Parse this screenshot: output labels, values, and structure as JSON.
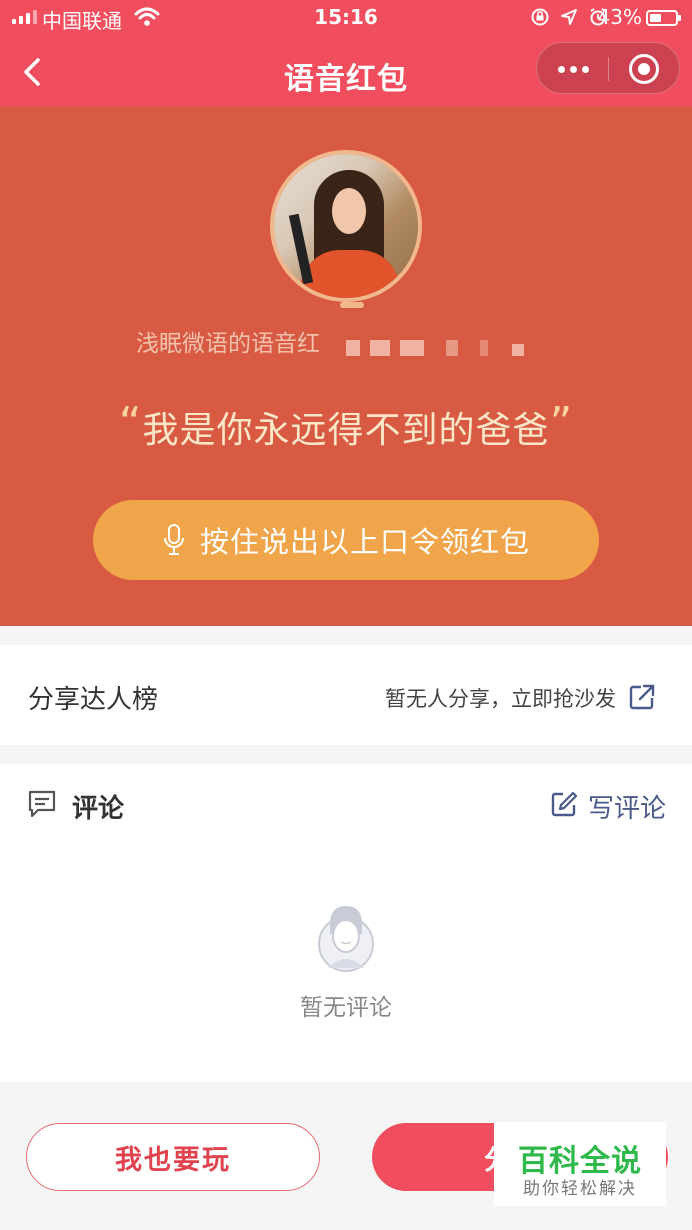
{
  "status_bar": {
    "carrier": "中国联通",
    "time": "15:16",
    "battery_percent": "43%",
    "battery_level": 0.43,
    "icons": [
      "signal-icon",
      "wifi-icon",
      "lock-rotation-icon",
      "location-icon",
      "alarm-icon",
      "battery-icon"
    ]
  },
  "nav": {
    "title": "语音红包",
    "icons": [
      "back-arrow-icon",
      "more-dots-icon",
      "close-target-icon"
    ]
  },
  "hero": {
    "sender_text": "浅眠微语的语音红",
    "quote_open": "“",
    "quote_text": "我是你永远得不到的爸爸",
    "quote_close": "”",
    "voice_button_label": "按住说出以上口令领红包",
    "voice_icon": "microphone-icon",
    "colors": {
      "background": "#d85a43",
      "button": "#f1a54a",
      "quote": "#fbe6c8"
    }
  },
  "share": {
    "label": "分享达人榜",
    "hint": "暂无人分享，立即抢沙发",
    "icon": "external-share-icon"
  },
  "comments": {
    "title": "评论",
    "write_label": "写评论",
    "empty_text": "暂无评论",
    "icons": [
      "comment-icon",
      "edit-icon",
      "empty-user-icon"
    ]
  },
  "bottom": {
    "play_label": "我也要玩",
    "share_label": "分",
    "colors": {
      "accent": "#f04e5e"
    }
  },
  "watermark": {
    "main": "百科全说",
    "sub": "助你轻松解决"
  }
}
